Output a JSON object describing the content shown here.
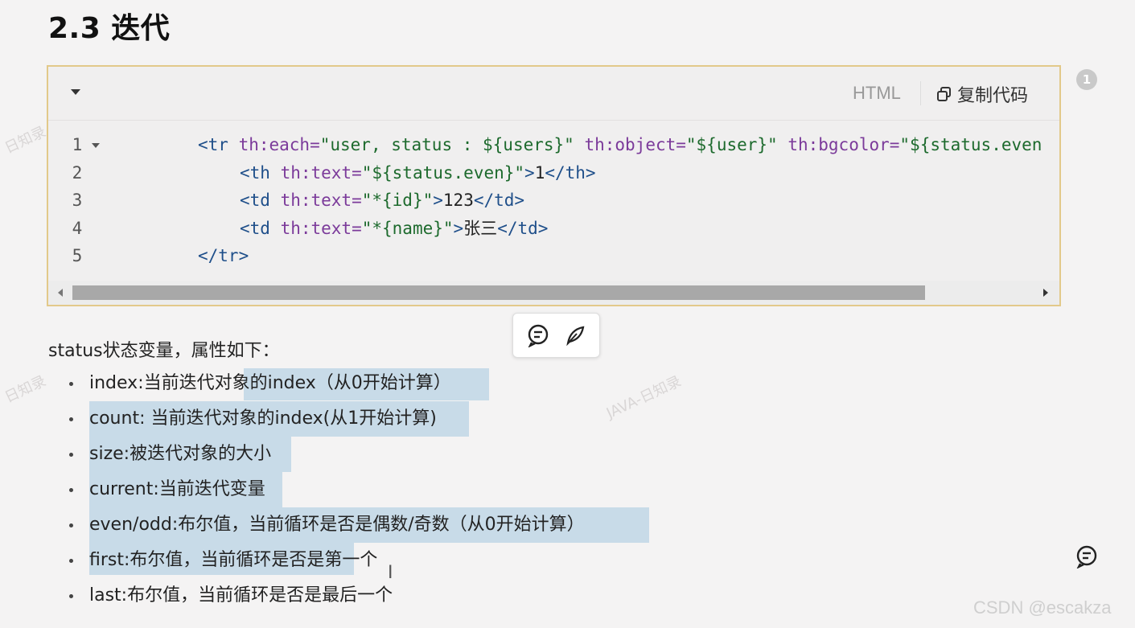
{
  "heading": "2.3 迭代",
  "code_block": {
    "language": "HTML",
    "copy_label": "复制代码",
    "lines": [
      {
        "num": "1",
        "parts": [
          [
            "tag",
            "<tr "
          ],
          [
            "attr",
            "th:each="
          ],
          [
            "str",
            "\"user, status : ${users}\""
          ],
          [
            "attr",
            " th:object="
          ],
          [
            "str",
            "\"${user}\""
          ],
          [
            "attr",
            " th:bgcolor="
          ],
          [
            "str",
            "\"${status.even"
          ]
        ]
      },
      {
        "num": "2",
        "parts": [
          [
            "tag",
            "<th "
          ],
          [
            "attr",
            "th:text="
          ],
          [
            "str",
            "\"${status.even}\""
          ],
          [
            "tag",
            ">"
          ],
          [
            "txt",
            "1"
          ],
          [
            "tag",
            "</th>"
          ]
        ]
      },
      {
        "num": "3",
        "parts": [
          [
            "tag",
            "<td "
          ],
          [
            "attr",
            "th:text="
          ],
          [
            "str",
            "\"*{id}\""
          ],
          [
            "tag",
            ">"
          ],
          [
            "txt",
            "123"
          ],
          [
            "tag",
            "</td>"
          ]
        ]
      },
      {
        "num": "4",
        "parts": [
          [
            "tag",
            "<td "
          ],
          [
            "attr",
            "th:text="
          ],
          [
            "str",
            "\"*{name}\""
          ],
          [
            "tag",
            ">"
          ],
          [
            "txt",
            "张三"
          ],
          [
            "tag",
            "</td>"
          ]
        ]
      },
      {
        "num": "5",
        "parts": [
          [
            "tag",
            "</tr>"
          ]
        ]
      }
    ]
  },
  "comment_count": "1",
  "intro": "status状态变量，属性如下：",
  "properties": [
    "index:当前迭代对象的index（从0开始计算）",
    "count: 当前迭代对象的index(从1开始计算)",
    "size:被迭代对象的大小",
    "current:当前迭代变量",
    "even/odd:布尔值，当前循环是否是偶数/奇数（从0开始计算）",
    "first:布尔值，当前循环是否是第一个",
    "last:布尔值，当前循环是否是最后一个"
  ],
  "highlight_color": "#c8dbe8",
  "frame_color": "#e2c98a",
  "watermarks": [
    "日知录",
    "JAVA-日知录",
    "日知录"
  ],
  "credit": "CSDN @escakza",
  "icons": {
    "collapse": "caret-down-icon",
    "copy": "copy-icon",
    "comment": "comment-icon",
    "pen": "pen-icon"
  }
}
